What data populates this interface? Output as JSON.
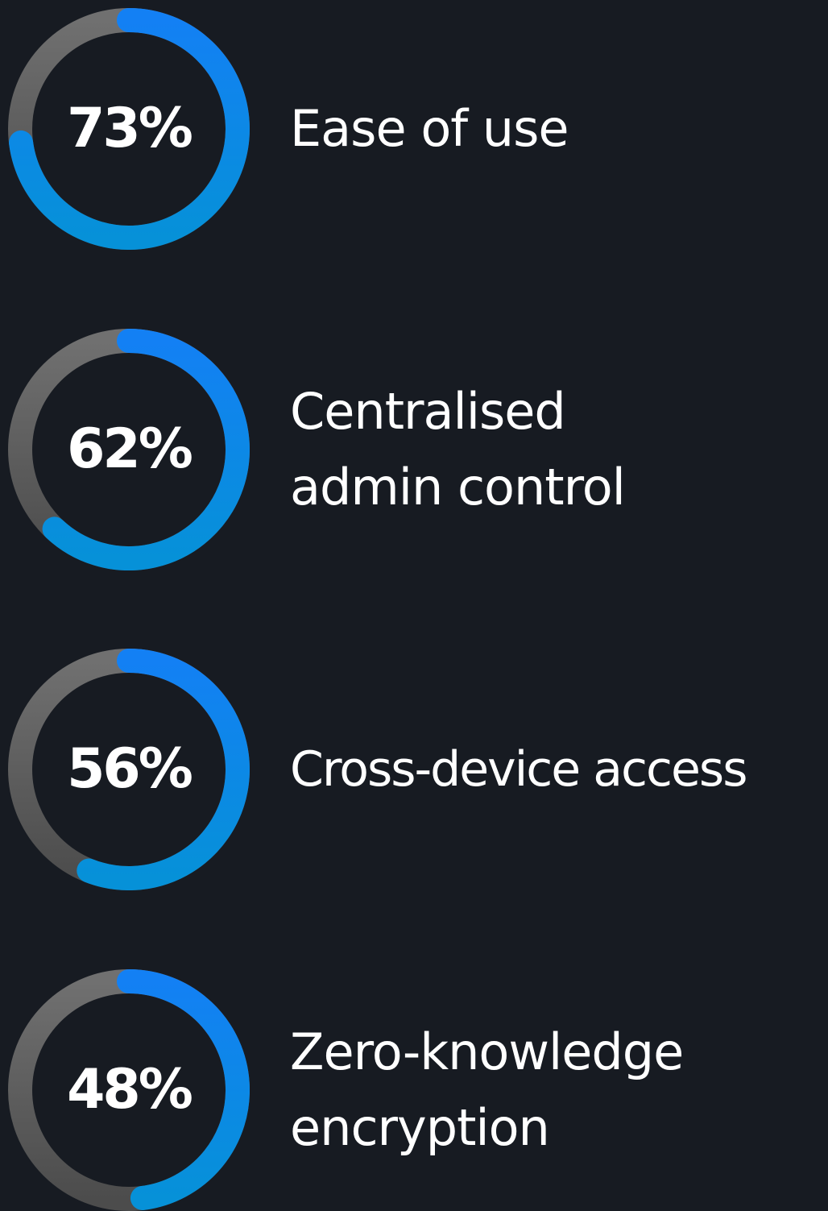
{
  "colors": {
    "background": "#171b22",
    "track_top": "#707070",
    "track_bottom": "#4c4c4c",
    "progress_top": "#1380f4",
    "progress_bottom": "#0691d8",
    "text": "#ffffff"
  },
  "chart_data": {
    "type": "donut",
    "items": [
      {
        "value": 73,
        "value_label": "73%",
        "label_lines": [
          "Ease of use"
        ]
      },
      {
        "value": 62,
        "value_label": "62%",
        "label_lines": [
          "Centralised",
          "admin control"
        ]
      },
      {
        "value": 56,
        "value_label": "56%",
        "label_lines": [
          "Cross-device access"
        ]
      },
      {
        "value": 48,
        "value_label": "48%",
        "label_lines": [
          "Zero-knowledge",
          "encryption"
        ]
      }
    ]
  }
}
